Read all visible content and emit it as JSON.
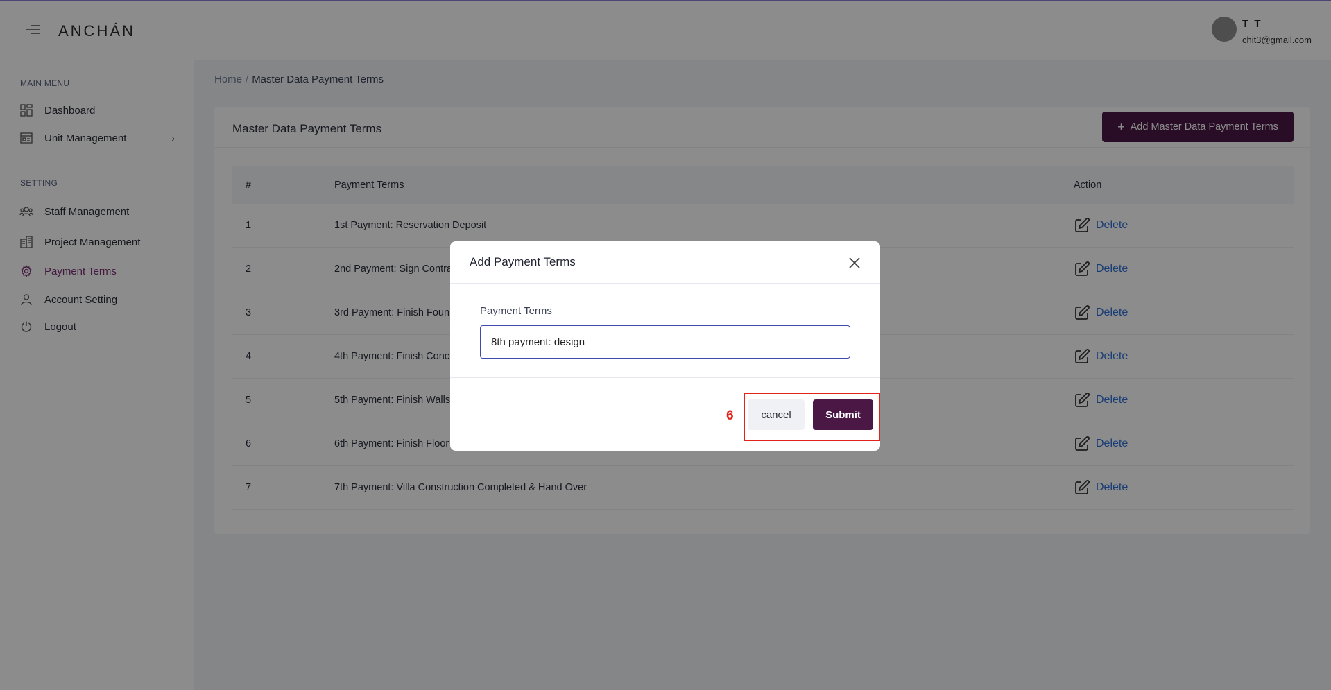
{
  "header": {
    "brand": "ANCHÁN",
    "user_name": "T T",
    "user_email": "chit3@gmail.com"
  },
  "sidebar": {
    "main_menu_label": "MAIN MENU",
    "setting_label": "SETTING",
    "main_items": [
      {
        "label": "Dashboard",
        "icon": "dashboard-grid-icon"
      },
      {
        "label": "Unit Management",
        "icon": "unit-card-icon"
      }
    ],
    "setting_items": [
      {
        "label": "Staff Management",
        "icon": "users-icon"
      },
      {
        "label": "Project Management",
        "icon": "building-icon"
      },
      {
        "label": "Payment Terms",
        "icon": "gear-icon",
        "active": true
      },
      {
        "label": "Account Setting",
        "icon": "user-icon"
      },
      {
        "label": "Logout",
        "icon": "power-icon"
      }
    ],
    "active_color": "#7b2d73"
  },
  "breadcrumb": {
    "home": "Home",
    "separator": "/",
    "current": "Master Data Payment Terms"
  },
  "card": {
    "title": "Master Data Payment Terms",
    "add_button_label": "Add Master Data Payment Terms",
    "columns": [
      "#",
      "Payment Terms",
      "Action"
    ],
    "rows": [
      {
        "num": "1",
        "term": "1st  Payment:  Reservation Deposit"
      },
      {
        "num": "2",
        "term": "2nd Payment: Sign Contra"
      },
      {
        "num": "3",
        "term": "3rd Payment: Finish Foun"
      },
      {
        "num": "4",
        "term": "4th Payment: Finish Conc"
      },
      {
        "num": "5",
        "term": "5th Payment: Finish Walls"
      },
      {
        "num": "6",
        "term": "6th Payment: Finish Floor"
      },
      {
        "num": "7",
        "term": "7th Payment: Villa Construction Completed & Hand Over"
      }
    ],
    "delete_label": "Delete"
  },
  "modal": {
    "title": "Add Payment Terms",
    "field_label": "Payment Terms",
    "field_value": "8th payment: design",
    "cancel_label": "cancel",
    "submit_label": "Submit"
  },
  "annotation": {
    "step_number": "6",
    "color": "#e2231a"
  },
  "colors": {
    "brand_primary": "#4b1846",
    "link": "#2f6fd6"
  }
}
